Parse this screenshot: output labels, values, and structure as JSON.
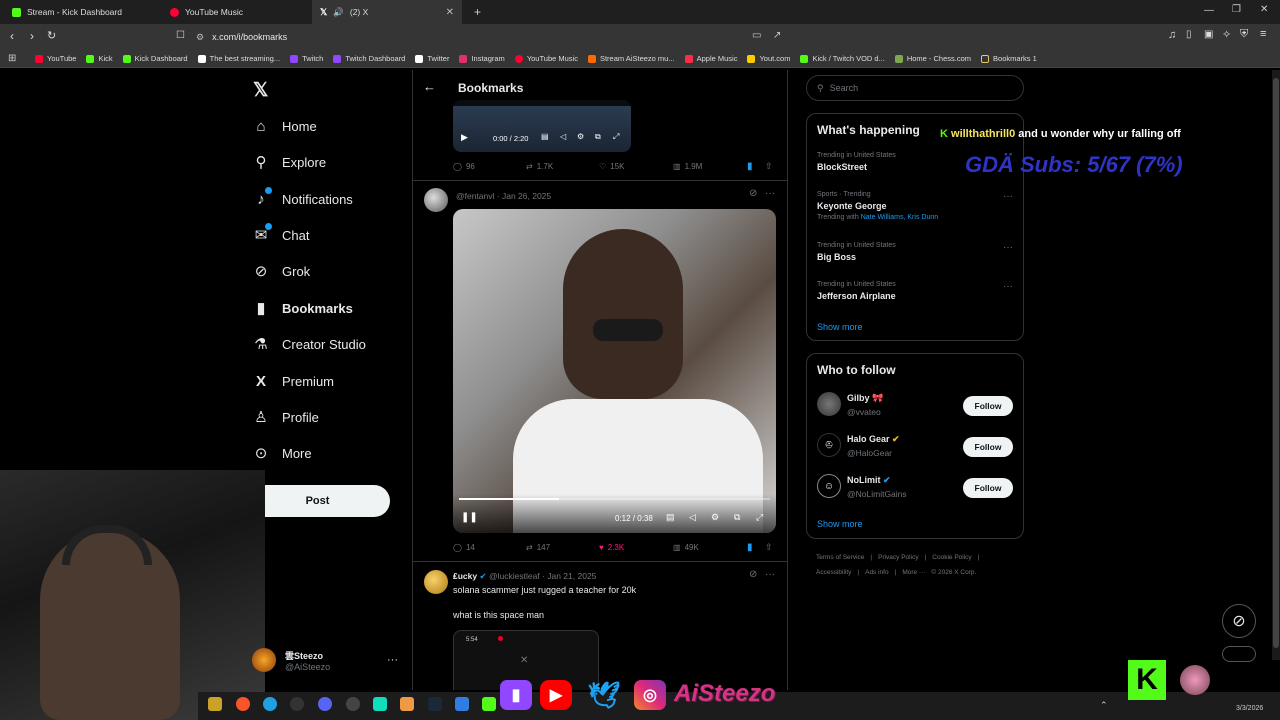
{
  "browser": {
    "tabs": [
      {
        "label": "Stream - Kick Dashboard",
        "fav_color": "#53fc18"
      },
      {
        "label": "YouTube Music",
        "fav_color": "#ff0033"
      },
      {
        "label": "(2) X",
        "fav_color": "#ffffff"
      }
    ],
    "new_tab": "+",
    "url": "x.com/i/bookmarks",
    "bookmarks": [
      {
        "label": "YouTube",
        "color": "#ff0033"
      },
      {
        "label": "Kick",
        "color": "#53fc18"
      },
      {
        "label": "Kick Dashboard",
        "color": "#53fc18"
      },
      {
        "label": "The best streaming...",
        "color": "#ffffff"
      },
      {
        "label": "Twitch",
        "color": "#9146ff"
      },
      {
        "label": "Twitch Dashboard",
        "color": "#9146ff"
      },
      {
        "label": "Twitter",
        "color": "#ffffff"
      },
      {
        "label": "Instagram",
        "color": "#e1306c"
      },
      {
        "label": "YouTube Music",
        "color": "#ff0033"
      },
      {
        "label": "Stream AiSteezo mu...",
        "color": "#ff6a00"
      },
      {
        "label": "Apple Music",
        "color": "#fa2d48"
      },
      {
        "label": "Yout.com",
        "color": "#ffcc00"
      },
      {
        "label": "Kick / Twitch VOD d...",
        "color": "#53fc18"
      },
      {
        "label": "Home - Chess.com",
        "color": "#7fa650"
      },
      {
        "label": "Bookmarks 1",
        "color": "#e8c56b"
      }
    ]
  },
  "nav": {
    "items": [
      {
        "label": "Home",
        "icon": "home-icon",
        "glyph": "⌂"
      },
      {
        "label": "Explore",
        "icon": "search-icon",
        "glyph": "⚲"
      },
      {
        "label": "Notifications",
        "icon": "bell-icon",
        "glyph": "🔔"
      },
      {
        "label": "Chat",
        "icon": "mail-icon",
        "glyph": "✉"
      },
      {
        "label": "Grok",
        "icon": "grok-icon",
        "glyph": "⊘"
      },
      {
        "label": "Bookmarks",
        "icon": "bookmark-icon",
        "glyph": "🔖"
      },
      {
        "label": "Creator Studio",
        "icon": "flask-icon",
        "glyph": "⚗"
      },
      {
        "label": "Premium",
        "icon": "x-logo-icon",
        "glyph": "𝕏"
      },
      {
        "label": "Profile",
        "icon": "person-icon",
        "glyph": "👤"
      },
      {
        "label": "More",
        "icon": "more-circle-icon",
        "glyph": "⊙"
      }
    ],
    "post_label": "Post",
    "account": {
      "name": "雲Steezo",
      "handle": "@AiSteezo"
    }
  },
  "header": {
    "title": "Bookmarks"
  },
  "post1": {
    "video_time": "0:00 / 2:20",
    "replies": "96",
    "reposts": "1.7K",
    "likes": "15K",
    "views": "1.9M"
  },
  "post2": {
    "handle": "@fentanvl",
    "date": "· Jan 26, 2025",
    "video_time": "0:12 / 0:38",
    "progress": 0.32,
    "replies": "14",
    "reposts": "147",
    "likes": "2.3K",
    "views": "49K"
  },
  "post3": {
    "name": "₤ucky",
    "handle": "@luckiestleaf",
    "date": "· Jan 21, 2025",
    "text1": "solana scammer just rugged a teacher for 20k",
    "text2": "what is this space man",
    "preview_time": "5:54"
  },
  "search": {
    "placeholder": "Search"
  },
  "trends": {
    "title": "What's happening",
    "items": [
      {
        "context": "Trending in United States",
        "name": "BlockStreet"
      },
      {
        "context": "Sports · Trending",
        "name": "Keyonte George",
        "with_label": "Trending with",
        "with": "Nate Williams, Kris Dunn"
      },
      {
        "context": "Trending in United States",
        "name": "Big Boss"
      },
      {
        "context": "Trending in United States",
        "name": "Jefferson Airplane"
      }
    ],
    "show_more": "Show more"
  },
  "follow": {
    "title": "Who to follow",
    "items": [
      {
        "name": "Gilby",
        "handle": "@vvateo"
      },
      {
        "name": "Halo Gear",
        "handle": "@HaloGear"
      },
      {
        "name": "NoLimit",
        "handle": "@NoLimitGains"
      }
    ],
    "button": "Follow",
    "show_more": "Show more"
  },
  "footer": {
    "row1": [
      "Terms of Service",
      "Privacy Policy",
      "Cookie Policy"
    ],
    "row2": [
      "Accessibility",
      "Ads info",
      "More ···",
      "© 2026 X Corp."
    ]
  },
  "overlay": {
    "chat_user": "willthathrill0",
    "chat_msg": "and u wonder why ur falling off",
    "subs": "GDÄ Subs: 5/67 (7%)",
    "brand": "AiSteezo",
    "date": "3/3/2026"
  }
}
